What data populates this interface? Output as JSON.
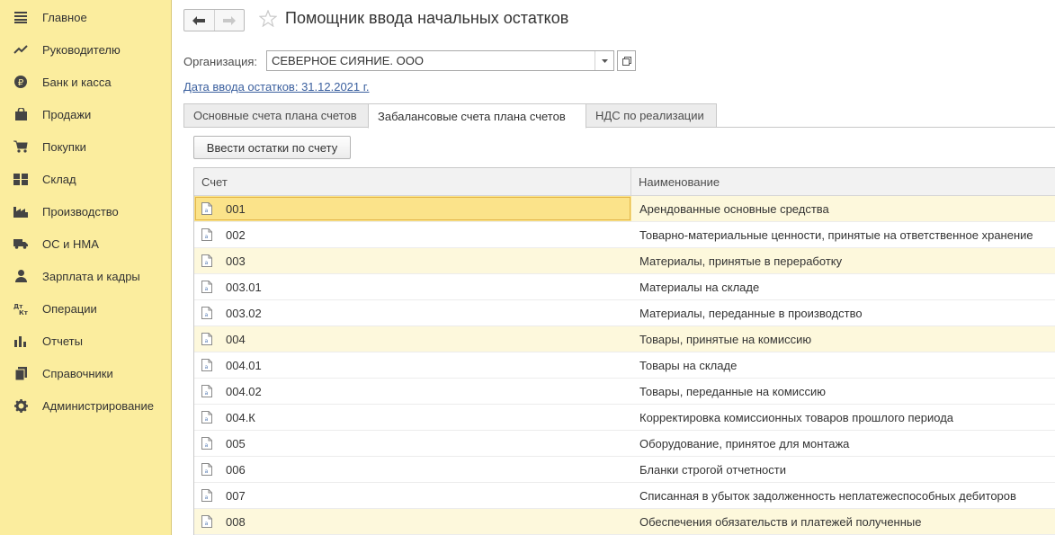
{
  "sidebar": {
    "items": [
      {
        "label": "Главное",
        "icon": "menu-lines-icon"
      },
      {
        "label": "Руководителю",
        "icon": "trend-icon"
      },
      {
        "label": "Банк и касса",
        "icon": "ruble-icon"
      },
      {
        "label": "Продажи",
        "icon": "bag-icon"
      },
      {
        "label": "Покупки",
        "icon": "cart-icon"
      },
      {
        "label": "Склад",
        "icon": "warehouse-icon"
      },
      {
        "label": "Производство",
        "icon": "factory-icon"
      },
      {
        "label": "ОС и НМА",
        "icon": "truck-icon"
      },
      {
        "label": "Зарплата и кадры",
        "icon": "person-icon"
      },
      {
        "label": "Операции",
        "icon": "dt-kt-icon"
      },
      {
        "label": "Отчеты",
        "icon": "bar-chart-icon"
      },
      {
        "label": "Справочники",
        "icon": "books-icon"
      },
      {
        "label": "Администрирование",
        "icon": "gear-icon"
      }
    ]
  },
  "header": {
    "title": "Помощник ввода начальных остатков"
  },
  "organization": {
    "label": "Организация:",
    "value": "СЕВЕРНОЕ СИЯНИЕ. ООО"
  },
  "date_link": "Дата ввода остатков: 31.12.2021 г.",
  "tabs": [
    {
      "label": "Основные счета плана счетов",
      "active": false
    },
    {
      "label": "Забалансовые счета плана счетов",
      "active": true
    },
    {
      "label": "НДС по реализации",
      "active": false
    }
  ],
  "enter_button": "Ввести остатки по счету",
  "table": {
    "columns": [
      "Счет",
      "Наименование"
    ],
    "rows": [
      {
        "account": "001",
        "name": "Арендованные основные средства",
        "highlight": true
      },
      {
        "account": "002",
        "name": "Товарно-материальные ценности, принятые на ответственное хранение",
        "highlight": false
      },
      {
        "account": "003",
        "name": "Материалы, принятые в переработку",
        "highlight": true
      },
      {
        "account": "003.01",
        "name": "Материалы на складе",
        "highlight": false
      },
      {
        "account": "003.02",
        "name": "Материалы, переданные в производство",
        "highlight": false
      },
      {
        "account": "004",
        "name": "Товары, принятые на комиссию",
        "highlight": true
      },
      {
        "account": "004.01",
        "name": "Товары на складе",
        "highlight": false
      },
      {
        "account": "004.02",
        "name": "Товары, переданные на комиссию",
        "highlight": false
      },
      {
        "account": "004.К",
        "name": "Корректировка комиссионных товаров прошлого периода",
        "highlight": false
      },
      {
        "account": "005",
        "name": "Оборудование, принятое для монтажа",
        "highlight": false
      },
      {
        "account": "006",
        "name": "Бланки строгой отчетности",
        "highlight": false
      },
      {
        "account": "007",
        "name": "Списанная в убыток задолженность неплатежеспособных дебиторов",
        "highlight": false
      },
      {
        "account": "008",
        "name": "Обеспечения обязательств и платежей полученные",
        "highlight": true
      }
    ]
  },
  "colors": {
    "sidebar_bg": "#fbed9e",
    "link": "#3a5f9e",
    "row_highlight": "#fdf8dc",
    "selected_cell": "#fbe38a"
  }
}
